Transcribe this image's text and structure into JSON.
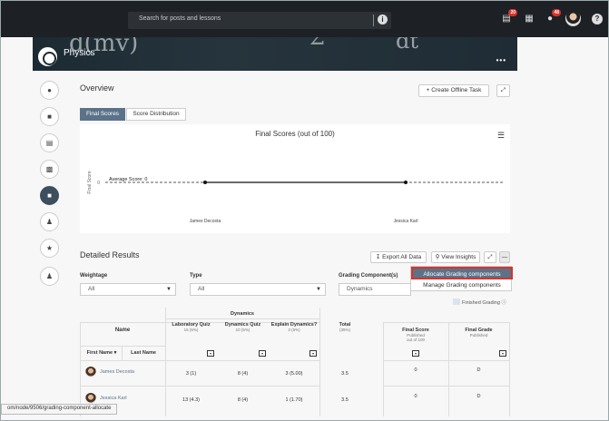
{
  "search": {
    "placeholder": "Search for posts and lessons"
  },
  "topbar": {
    "badge_updates": "20",
    "badge_notifications": "48"
  },
  "course": {
    "title": "Physics"
  },
  "overview": {
    "heading": "Overview",
    "create_offline_task": "Create Offline Task"
  },
  "tabs": [
    {
      "label": "Final Scores",
      "active": true
    },
    {
      "label": "Score Distribution",
      "active": false
    }
  ],
  "chart_data": {
    "type": "line",
    "title": "Final Scores (out of 100)",
    "ylabel": "Final Score",
    "categories": [
      "James Decosta",
      "Jessica Karl"
    ],
    "series": [
      {
        "values": [
          0,
          0
        ]
      }
    ],
    "annotations": [
      {
        "label": "Average Score: 0",
        "y": 0
      }
    ],
    "ytick": "0"
  },
  "detailed": {
    "heading": "Detailed Results",
    "export_all_data": "Export All Data",
    "view_insights": "View Insights"
  },
  "filters": {
    "weightage_label": "Weightage",
    "weightage_value": "All",
    "type_label": "Type",
    "type_value": "All",
    "grading_label": "Grading Component(s)",
    "grading_value": "Dynamics"
  },
  "menu": {
    "allocate": "Allocate Grading components",
    "manage": "Manage Grading components"
  },
  "finished_grading": "Finished Grading",
  "table": {
    "name_header": "Name",
    "first_name": "First Name ▾",
    "last_name": "Last Name",
    "group_header": "Dynamics",
    "columns": [
      {
        "title": "Laboratory Quiz",
        "sub": "15 (5%)"
      },
      {
        "title": "Dynamics Quiz",
        "sub": "10 (5%)"
      },
      {
        "title": "Explain Dynamics?",
        "sub": "3 (5%)"
      },
      {
        "title": "Total",
        "sub": "(35%)"
      }
    ],
    "final_score": {
      "title": "Final Score",
      "sub1": "Published",
      "sub2": "out of 100"
    },
    "final_grade": {
      "title": "Final Grade",
      "sub1": "Published"
    },
    "rows": [
      {
        "name": "James Decosta",
        "lab": "3 (1)",
        "dq": "8 (4)",
        "ed": "3 (5.00)",
        "total": "3.5",
        "score": "0",
        "grade": "D"
      },
      {
        "name": "Jessica Karl",
        "lab": "13 (4.3)",
        "dq": "8 (4)",
        "ed": "1 (1.70)",
        "total": "3.5",
        "score": "0",
        "grade": "D"
      }
    ]
  },
  "status_url": "om/node/9506/grading-component-allocate"
}
